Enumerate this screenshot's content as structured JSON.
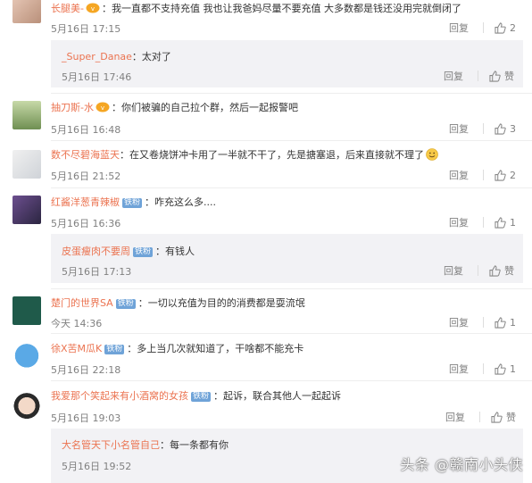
{
  "actions": {
    "reply": "回复",
    "like": "赞"
  },
  "comments": [
    {
      "user": "长腿美-",
      "text": "：我一直都不支持充值 我也让我爸妈尽量不要充值 大多数都是钱还没用完就倒闭了",
      "time": "5月16日 17:15",
      "likes": "2"
    },
    {
      "user": "_Super_Danae",
      "text": "：太对了",
      "time": "5月16日 17:46"
    },
    {
      "user": "抽刀斯-水",
      "text": "：你们被骗的自己拉个群，然后一起报警吧",
      "time": "5月16日 16:48",
      "likes": "3"
    },
    {
      "user": "数不尽碧海蓝天",
      "text": "：在又卷烧饼冲卡用了一半就不干了，先是搪塞退，后来直接就不理了",
      "time": "5月16日 21:52",
      "likes": "2"
    },
    {
      "user": "红酱洋葱青辣椒",
      "badge": "铁粉",
      "text": "：咋充这么多....",
      "time": "5月16日 16:36",
      "likes": "1"
    },
    {
      "user": "皮蛋瘦肉不要周",
      "badge": "铁粉",
      "text": "：有钱人",
      "time": "5月16日 17:13"
    },
    {
      "user": "楚门的世界SA",
      "badge": "铁粉",
      "text": "：一切以充值为目的的消费都是耍流氓",
      "time": "今天 14:36",
      "likes": "1"
    },
    {
      "user": "徐X苦M瓜K",
      "badge": "铁粉",
      "text": "：多上当几次就知道了，干啥都不能充卡",
      "time": "5月16日 22:18",
      "likes": "1"
    },
    {
      "user": "我爱那个笑起来有小酒窝的女孩",
      "badge": "铁粉",
      "text": "：起诉，联合其他人一起起诉",
      "time": "5月16日 19:03"
    },
    {
      "user": "大名管天下小名管自己",
      "text": "：每一条都有你",
      "time": "5月16日 19:52"
    }
  ],
  "watermark": "头条 @赣南小头侠",
  "colors": {
    "username": "#eb7350",
    "reply_bg": "#f2f2f5",
    "badge": "#6fa3d8"
  }
}
